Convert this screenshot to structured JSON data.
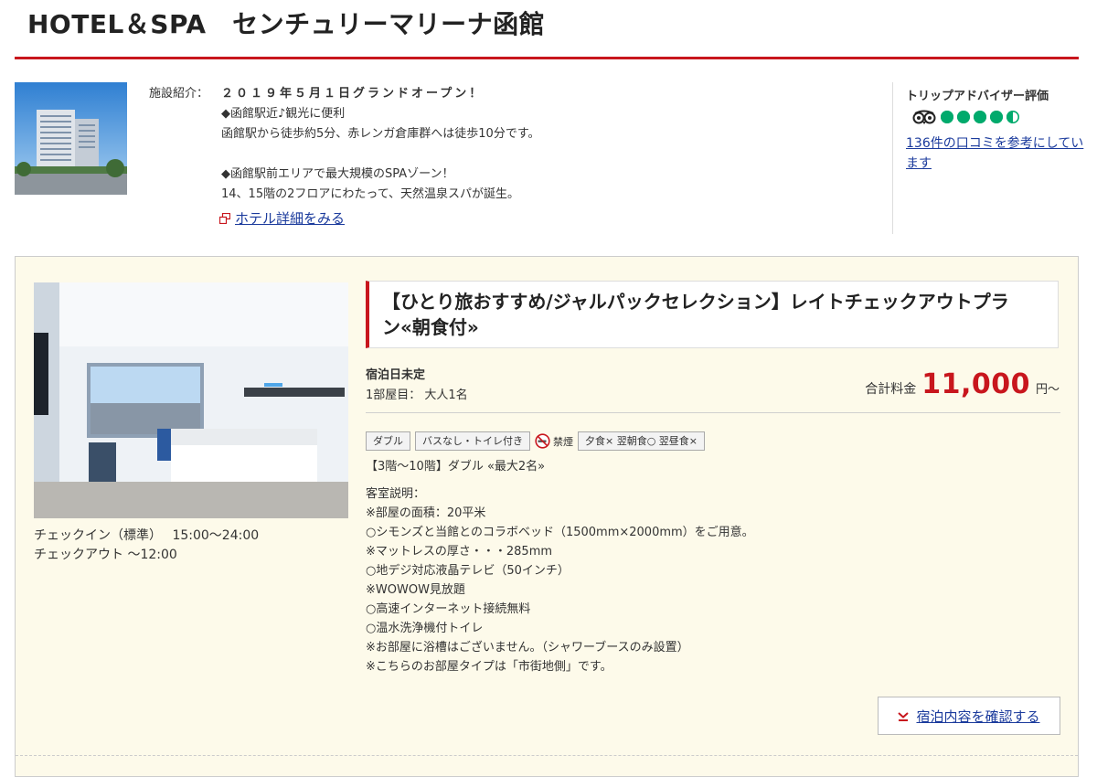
{
  "hotel": {
    "name": "HOTEL＆SPA　センチュリーマリーナ函館",
    "intro_label": "施設紹介：",
    "intro_lines": [
      "２０１９年５月１日グランドオープン！",
      "◆函館駅近♪観光に便利",
      "函館駅から徒歩約5分、赤レンガ倉庫群へは徒歩10分です。",
      "",
      "◆函館駅前エリアで最大規模のSPAゾーン！",
      "14、15階の2フロアにわたって、天然温泉スパが誕生。"
    ],
    "detail_link": "ホテル詳細をみる"
  },
  "review": {
    "title": "トリップアドバイザー評価",
    "rating": 4.5,
    "rating_max": 5,
    "link": "136件の口コミを参考にしています",
    "logo_icon": "tripadvisor-owl-icon",
    "color": "#00aa6c"
  },
  "plan": {
    "title": "【ひとり旅おすすめ/ジャルパックセレクション】レイトチェックアウトプラン«朝食付»",
    "stay_date": "宿泊日未定",
    "room_guests": "1部屋目： 大人1名",
    "price_label": "合計料金",
    "price": "11,000",
    "price_unit": "円～",
    "checkin": "チェックイン（標準）　 15:00～24:00",
    "checkout": "チェックアウト ～12:00",
    "tags": [
      "ダブル",
      "バスなし・トイレ付き"
    ],
    "nosmoking_label": "禁煙",
    "meal_tag": "夕食× 翌朝食○ 翌昼食×",
    "room_type": "【3階～10階】ダブル «最大2名»",
    "description": [
      "客室説明：",
      "※部屋の面積：20平米",
      "○シモンズと当館とのコラボベッド（1500mm×2000mm）をご用意。",
      "※マットレスの厚さ・・・285mm",
      "○地デジ対応液晶テレビ（50インチ）",
      "※WOWOW見放題",
      "○高速インターネット接続無料",
      "○温水洗浄機付トイレ",
      "※お部屋に浴槽はございません。（シャワーブースのみ設置）",
      "※こちらのお部屋タイプは「市街地側」です。"
    ],
    "confirm_button": "宿泊内容を確認する"
  },
  "colors": {
    "accent_red": "#c8161d",
    "link_blue": "#1a3a9c",
    "card_bg": "#fdfaea"
  }
}
